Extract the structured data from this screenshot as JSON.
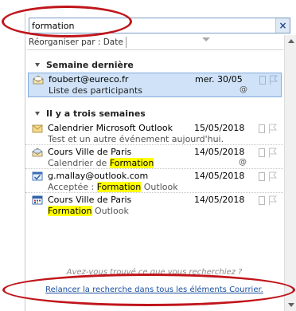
{
  "search": {
    "value": "formation",
    "clear_label": "×"
  },
  "arrange": {
    "label": "Réorganiser par : Date"
  },
  "groups": [
    {
      "label": "Semaine dernière",
      "items": [
        {
          "icon": "envelope-open-icon",
          "sender": "foubert@eureco.fr",
          "date": "mer. 30/05",
          "subject": "Liste des participants",
          "attachment": true,
          "selected": true
        }
      ]
    },
    {
      "label": "Il y a trois semaines",
      "items": [
        {
          "icon": "envelope-icon",
          "sender": "Calendrier Microsoft Outlook",
          "date": "15/05/2018",
          "subject": "Test et un autre événement aujourd'hui.",
          "attachment": false
        },
        {
          "icon": "envelope-open-icon",
          "sender": "Cours Ville de Paris",
          "date": "14/05/2018",
          "subject_prefix": "Calendrier de ",
          "subject_highlight": "Formation",
          "subject_suffix": "",
          "attachment": true
        },
        {
          "icon": "meeting-accepted-icon",
          "sender": "g.mallay@outlook.com",
          "date": "14/05/2018",
          "subject_prefix": "Acceptée : ",
          "subject_highlight": "Formation",
          "subject_suffix": " Outlook",
          "attachment": false
        },
        {
          "icon": "calendar-invite-icon",
          "sender": "Cours Ville de Paris",
          "date": "14/05/2018",
          "subject_prefix": "",
          "subject_highlight": "Formation",
          "subject_suffix": " Outlook",
          "attachment": false
        }
      ]
    }
  ],
  "clip_glyph": "@",
  "footer": {
    "question": "Avez-vous trouvé ce que vous recherchiez ?",
    "link": "Relancer la recherche dans tous les éléments Courrier."
  },
  "colors": {
    "annotation": "#c0151b",
    "highlight": "#ffff00",
    "selection": "#cfe2f7",
    "link": "#1a4fa0"
  }
}
